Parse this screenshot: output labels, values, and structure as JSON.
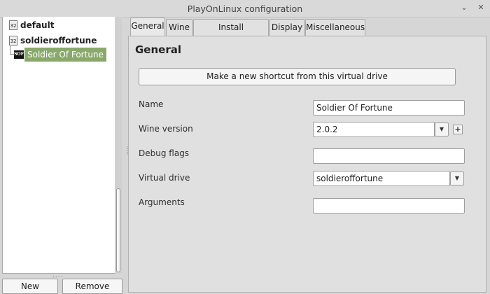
{
  "window": {
    "title": "PlayOnLinux configuration",
    "minimize_glyph": "⌄",
    "close_glyph": "✕"
  },
  "tree": {
    "items": [
      {
        "label": "default",
        "icon": "32",
        "icon_name": "wine-prefix-32bit-icon"
      },
      {
        "label": "soldieroffortune",
        "icon": "32",
        "icon_name": "wine-prefix-32bit-icon",
        "children": [
          {
            "label": "Soldier Of Fortune",
            "icon": "SOF",
            "icon_name": "soldier-of-fortune-icon",
            "selected": true
          }
        ]
      }
    ]
  },
  "left_buttons": {
    "new": "New",
    "remove": "Remove"
  },
  "tabs": [
    {
      "label": "General",
      "active": true
    },
    {
      "label": "Wine",
      "active": false
    },
    {
      "label": "Install components",
      "active": false
    },
    {
      "label": "Display",
      "active": false
    },
    {
      "label": "Miscellaneous",
      "active": false
    }
  ],
  "general": {
    "heading": "General",
    "shortcut_button": "Make a new shortcut from this virtual drive",
    "fields": {
      "name": {
        "label": "Name",
        "value": "Soldier Of Fortune"
      },
      "wine_version": {
        "label": "Wine version",
        "value": "2.0.2"
      },
      "debug_flags": {
        "label": "Debug flags",
        "value": ""
      },
      "virtual_drive": {
        "label": "Virtual drive",
        "value": "soldieroffortune"
      },
      "arguments": {
        "label": "Arguments",
        "value": ""
      }
    }
  },
  "colors": {
    "selection": "#89a96b",
    "window_bg": "#d6d6d6"
  }
}
